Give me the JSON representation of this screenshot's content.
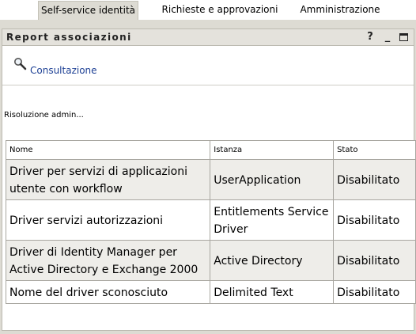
{
  "tabs": [
    {
      "label": "Self-service identità",
      "active": true
    },
    {
      "label": "Richieste e approvazioni",
      "active": false
    },
    {
      "label": "Amministrazione",
      "active": false
    }
  ],
  "portlet": {
    "title": "Report associazioni",
    "help": "?",
    "minimize": "_"
  },
  "actions": {
    "consultazione": "Consultazione",
    "icon": "magnifier-icon"
  },
  "status_text": "Risoluzione admin...",
  "table": {
    "headers": [
      "Nome",
      "Istanza",
      "Stato"
    ],
    "rows": [
      {
        "nome": "Driver per servizi di applicazioni utente con workflow",
        "istanza": "UserApplication",
        "stato": "Disabilitato"
      },
      {
        "nome": "Driver servizi autorizzazioni",
        "istanza": "Entitlements Service Driver",
        "stato": "Disabilitato"
      },
      {
        "nome": "Driver di Identity Manager per Active Directory e Exchange 2000",
        "istanza": "Active Directory",
        "stato": "Disabilitato"
      },
      {
        "nome": "Nome del driver sconosciuto",
        "istanza": "Delimited Text",
        "stato": "Disabilitato"
      }
    ]
  },
  "colors": {
    "tab_active_bg": "#dddbd3",
    "link": "#1c3f94",
    "row_alt": "#eeede9"
  }
}
